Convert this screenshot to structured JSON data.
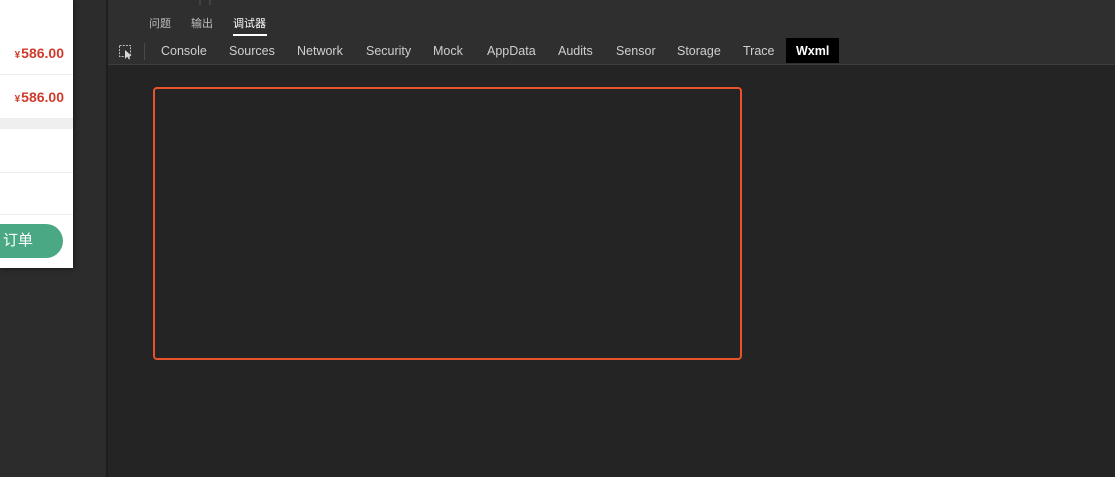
{
  "simulator": {
    "rows": [
      {
        "currency": "¥",
        "amount": "586.00"
      },
      {
        "currency": "¥",
        "amount": "586.00"
      }
    ],
    "order_button_label": "订单",
    "colors": {
      "price": "#cf3b2c",
      "button": "#4aa884"
    }
  },
  "devtools": {
    "top_tabs": [
      {
        "label": "问题",
        "active": false
      },
      {
        "label": "输出",
        "active": false
      },
      {
        "label": "调试器",
        "active": true
      }
    ],
    "inspect_icon": "cursor-select-icon",
    "tabs": [
      {
        "label": "Console",
        "active": false
      },
      {
        "label": "Sources",
        "active": false
      },
      {
        "label": "Network",
        "active": false
      },
      {
        "label": "Security",
        "active": false
      },
      {
        "label": "Mock",
        "active": false
      },
      {
        "label": "AppData",
        "active": false
      },
      {
        "label": "Audits",
        "active": false
      },
      {
        "label": "Sensor",
        "active": false
      },
      {
        "label": "Storage",
        "active": false
      },
      {
        "label": "Trace",
        "active": false
      },
      {
        "label": "Wxml",
        "active": true
      }
    ],
    "colors": {
      "highlight_border": "#e8532b",
      "panel_bg": "#242424"
    }
  }
}
